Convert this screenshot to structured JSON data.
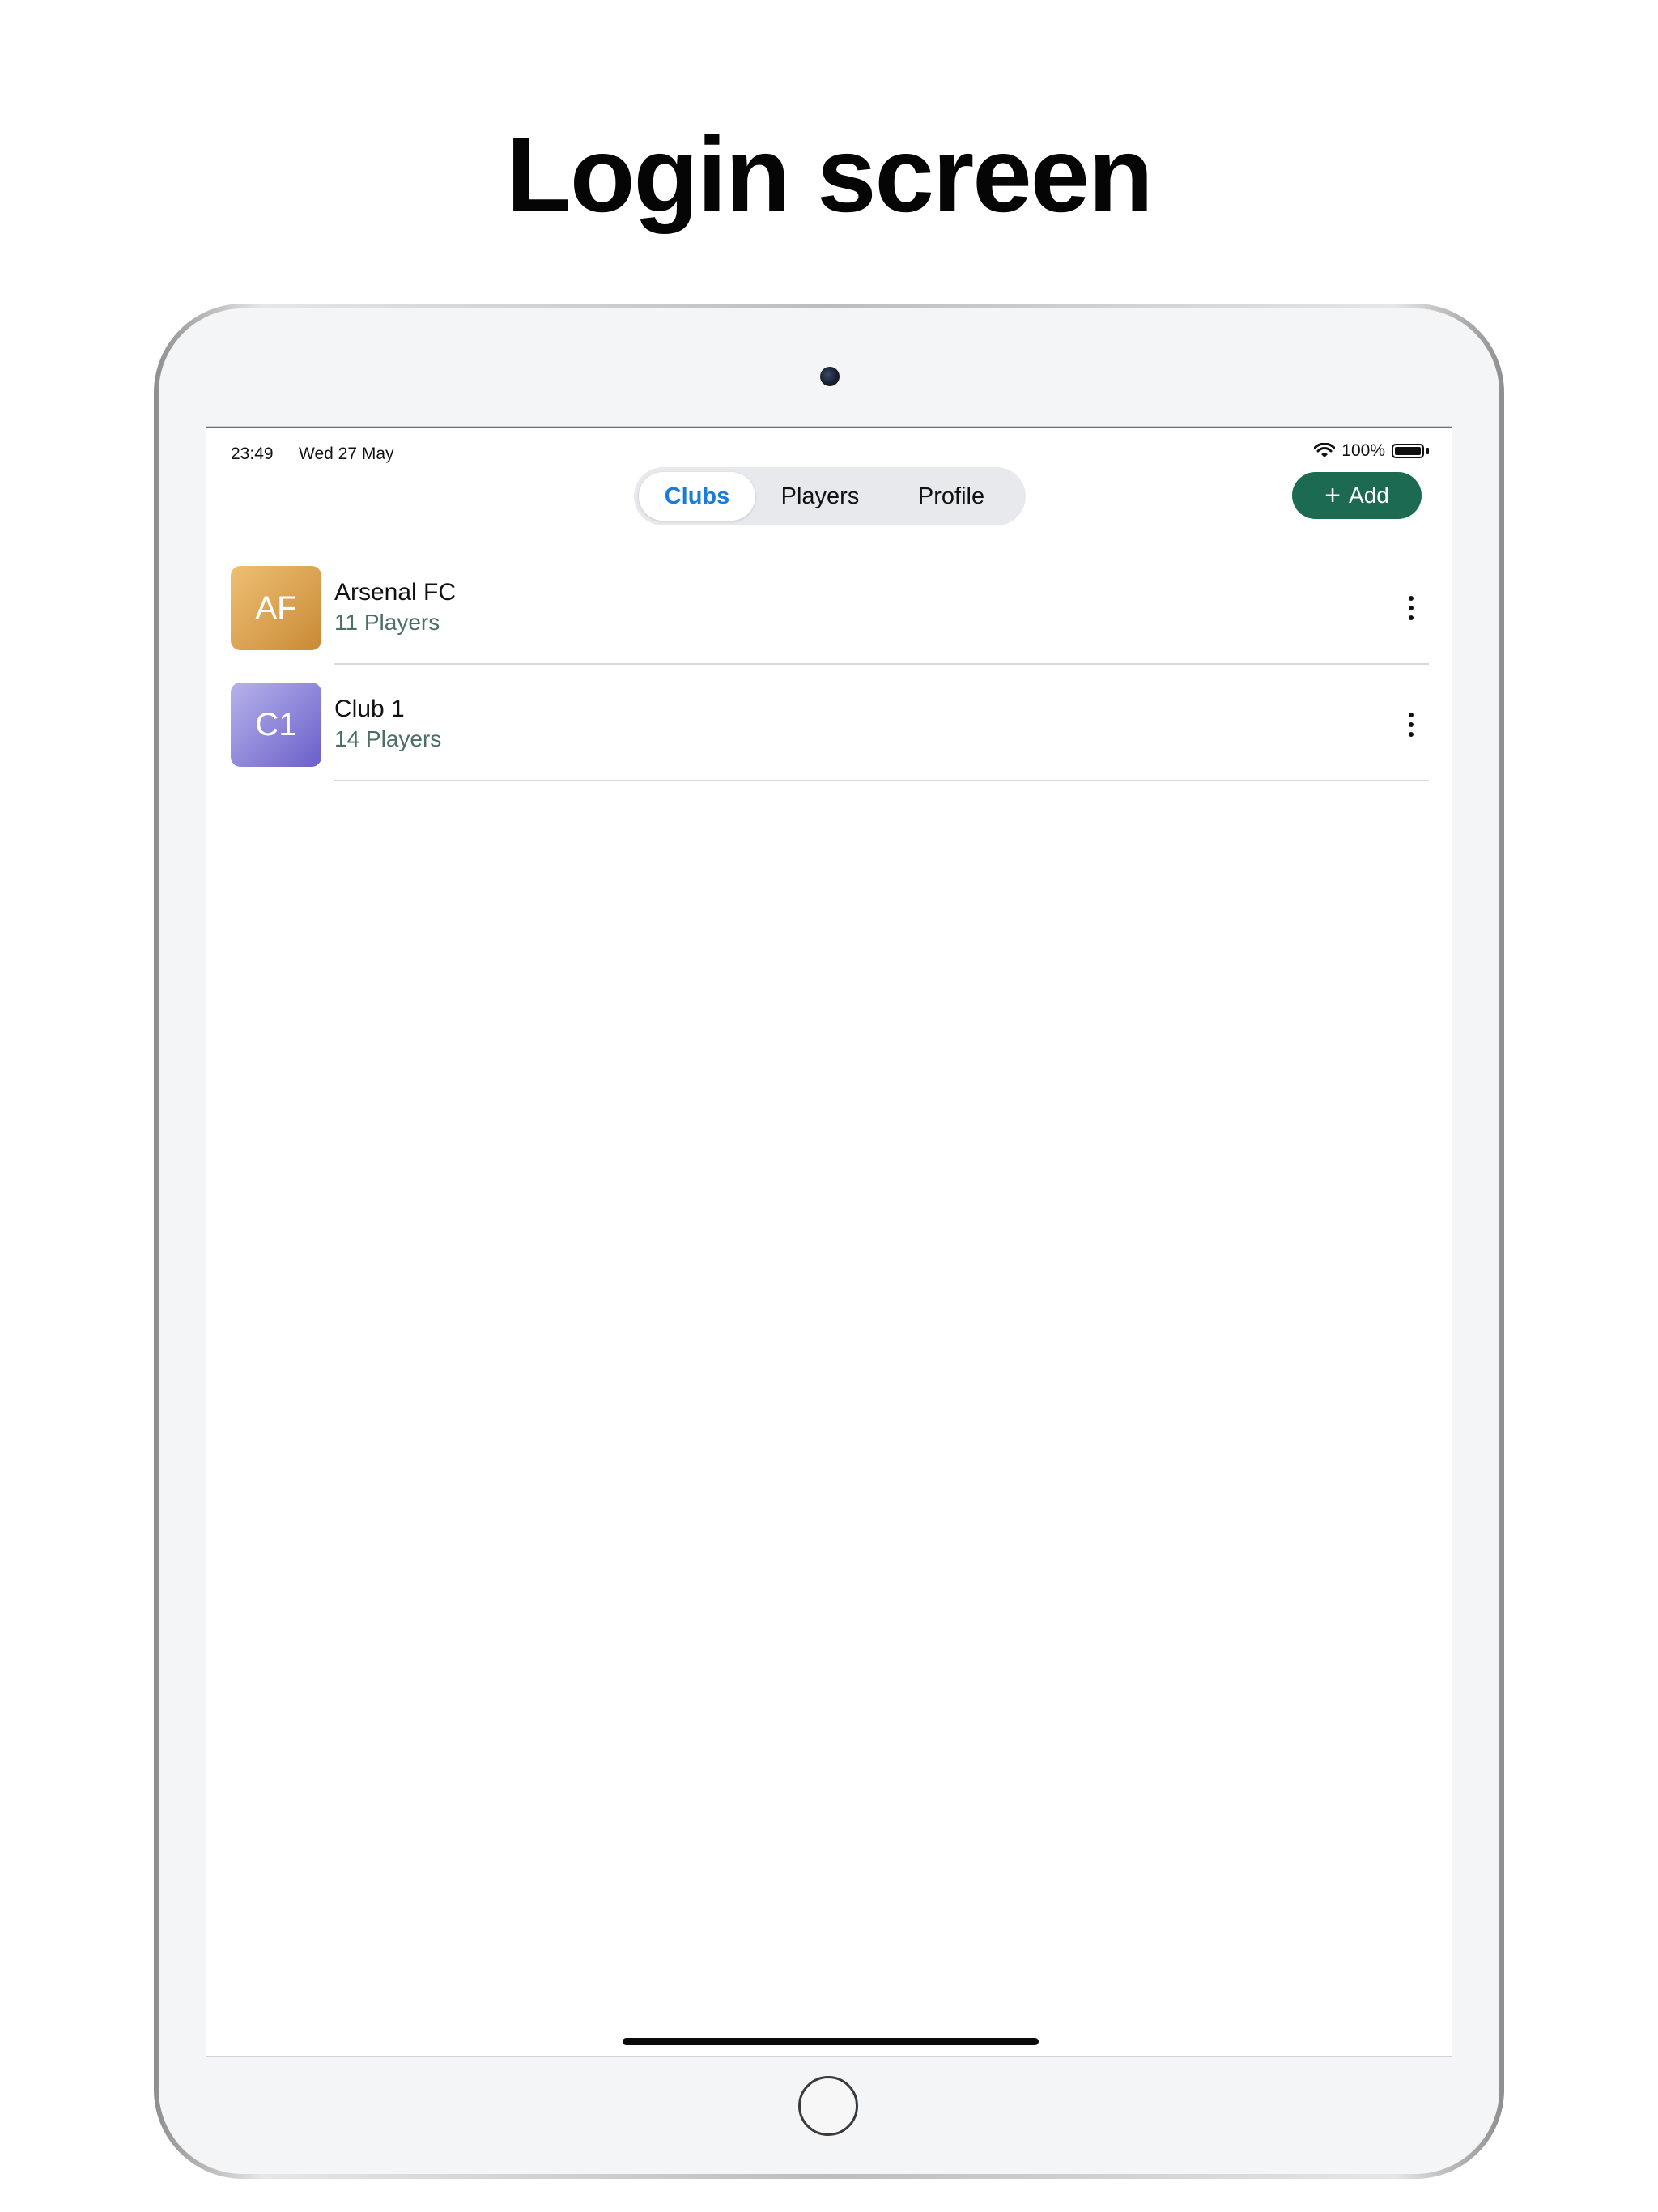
{
  "page": {
    "headline": "Login screen"
  },
  "status_bar": {
    "time": "23:49",
    "date": "Wed 27 May",
    "battery": "100%"
  },
  "tabs": [
    {
      "label": "Clubs",
      "active": true
    },
    {
      "label": "Players",
      "active": false
    },
    {
      "label": "Profile",
      "active": false
    }
  ],
  "toolbar": {
    "add_label": "Add"
  },
  "clubs": [
    {
      "initials": "AF",
      "name": "Arsenal FC",
      "players": "11 Players",
      "color_from": "#eebf73",
      "color_to": "#c88a35"
    },
    {
      "initials": "C1",
      "name": "Club 1",
      "players": "14 Players",
      "color_from": "#b7b3ea",
      "color_to": "#6a5fca"
    }
  ],
  "colors": {
    "accent": "#1b7bd9",
    "add_button": "#1c6a52",
    "subtitle": "#4d6e66"
  }
}
